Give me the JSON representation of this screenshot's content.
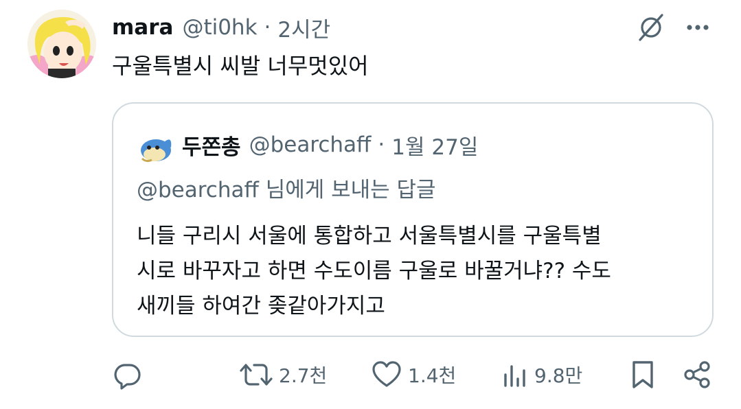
{
  "tweet": {
    "author": {
      "name": "mara",
      "handle": "@ti0hk",
      "separator": "·",
      "time": "2시간"
    },
    "text": "구울특별시 씨발 너무멋있어",
    "quote": {
      "author": {
        "name": "두쫀총",
        "handle": "@bearchaff",
        "separator": "·",
        "time": "1월 27일"
      },
      "reply_to": "@bearchaff 님에게 보내는 답글",
      "text_lines": [
        "니들 구리시 서울에 통합하고 서울특별시를 구울특별",
        "시로 바꾸자고 하면 수도이름 구울로 바꿀거냐?? 수도",
        "새끼들 하여간 좆같아가지고"
      ]
    },
    "actions": {
      "reply_icon": "reply-icon",
      "retweet_icon": "retweet-icon",
      "retweet_count": "2.7천",
      "like_icon": "heart-icon",
      "like_count": "1.4천",
      "views_icon": "views-icon",
      "views_count": "9.8만",
      "bookmark_icon": "bookmark-icon",
      "share_icon": "share-icon"
    },
    "header_icons": {
      "grok": "grok-icon",
      "more": "more-icon"
    }
  },
  "colors": {
    "primary_text": "#0f1419",
    "secondary_text": "#536471",
    "border": "#cfd9de",
    "background": "#ffffff"
  }
}
